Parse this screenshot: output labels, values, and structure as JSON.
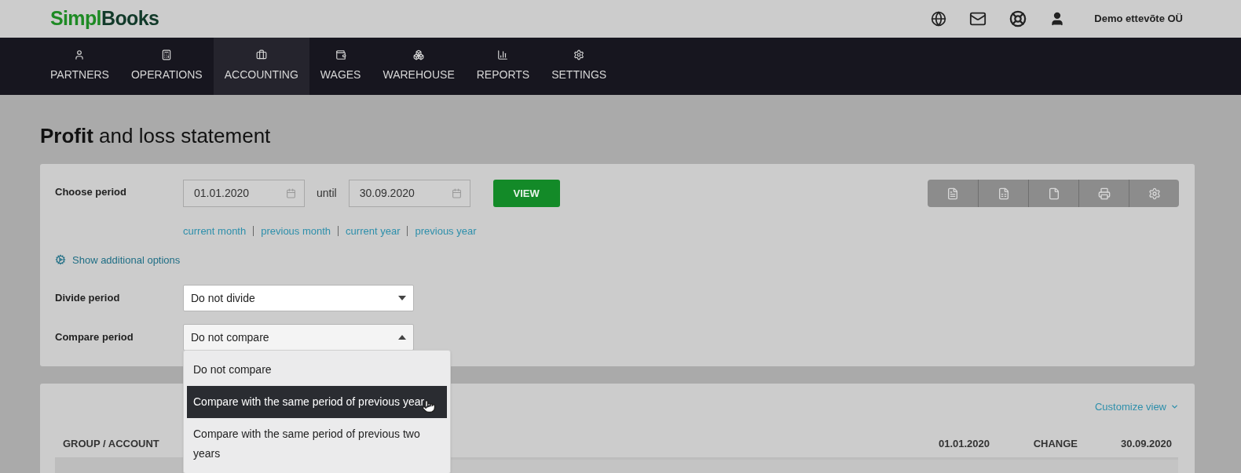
{
  "header": {
    "logo": {
      "first": "Simpl",
      "second": "Books"
    },
    "company": "Demo ettevõte OÜ"
  },
  "nav": [
    {
      "label": "PARTNERS",
      "selected": false
    },
    {
      "label": "OPERATIONS",
      "selected": false
    },
    {
      "label": "ACCOUNTING",
      "selected": true
    },
    {
      "label": "WAGES",
      "selected": false
    },
    {
      "label": "WAREHOUSE",
      "selected": false
    },
    {
      "label": "REPORTS",
      "selected": false
    },
    {
      "label": "SETTINGS",
      "selected": false
    }
  ],
  "page_title": "**Profit** and loss statement",
  "filters": {
    "choose_period": {
      "label": "Choose period",
      "from": "01.01.2020",
      "until_label": "until",
      "to": "30.09.2020",
      "view_button": "VIEW"
    },
    "quick_links": [
      "current month",
      "previous month",
      "current year",
      "previous year"
    ],
    "additional_options": "Show additional options",
    "divide": {
      "label": "Divide period",
      "value": "Do not divide",
      "expanded": false
    },
    "compare": {
      "label": "Compare period",
      "value": "Do not compare",
      "expanded": true,
      "options": [
        {
          "label": "Do not compare",
          "highlighted": false
        },
        {
          "label": "Compare with the same period of previous year",
          "highlighted": true
        },
        {
          "label": "Compare with the same period of previous two years",
          "highlighted": false
        }
      ]
    }
  },
  "report": {
    "customize_view": "Customize view",
    "columns": [
      "GROUP / ACCOUNT",
      "01.01.2020",
      "CHANGE",
      "30.09.2020"
    ]
  }
}
